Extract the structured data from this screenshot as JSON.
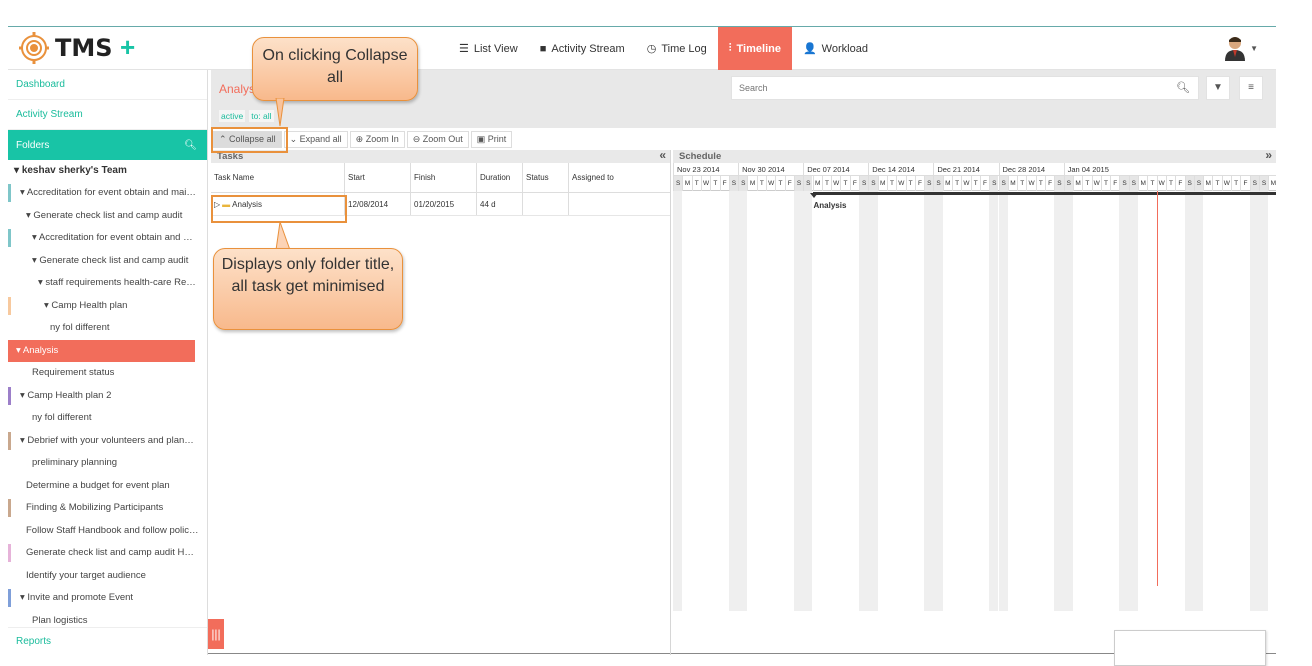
{
  "app": {
    "name": "TMS"
  },
  "nav": [
    {
      "label": "List View",
      "icon": "☰"
    },
    {
      "label": "Activity Stream",
      "icon": "■"
    },
    {
      "label": "Time Log",
      "icon": "◷"
    },
    {
      "label": "Timeline",
      "icon": "⫶"
    },
    {
      "label": "Workload",
      "icon": "👤"
    }
  ],
  "sidebar": {
    "dashboard": "Dashboard",
    "activity": "Activity Stream",
    "folders": "Folders",
    "team": "keshav sherky's Team",
    "items": [
      {
        "label": "Accreditation for event obtain and maintained",
        "indent": 1,
        "arrow": true,
        "color": "#7fc6c9"
      },
      {
        "label": "Generate check list and camp audit",
        "indent": 2,
        "arrow": true,
        "color": ""
      },
      {
        "label": "Accreditation for event obtain and maintained",
        "indent": 3,
        "arrow": true,
        "color": "#7fc6c9"
      },
      {
        "label": "Generate check list and camp audit",
        "indent": 3,
        "arrow": true,
        "color": ""
      },
      {
        "label": "staff requirements health-care Responsibilities",
        "indent": 4,
        "arrow": true,
        "color": ""
      },
      {
        "label": "Camp Health plan",
        "indent": 5,
        "arrow": true,
        "color": "#f7c99e"
      },
      {
        "label": "ny fol different",
        "indent": 6,
        "arrow": false,
        "color": ""
      },
      {
        "label": "Analysis",
        "indent": 1,
        "arrow": true,
        "color": "",
        "selected": true
      },
      {
        "label": "Requirement status",
        "indent": 3,
        "arrow": false,
        "color": ""
      },
      {
        "label": "Camp Health plan 2",
        "indent": 1,
        "arrow": true,
        "color": "#9c7fc9"
      },
      {
        "label": "ny fol different",
        "indent": 3,
        "arrow": false,
        "color": ""
      },
      {
        "label": "Debrief with your volunteers and planning",
        "indent": 1,
        "arrow": true,
        "color": "#c9a88e"
      },
      {
        "label": "preliminary planning",
        "indent": 3,
        "arrow": false,
        "color": ""
      },
      {
        "label": "Determine a budget for event plan",
        "indent": 2,
        "arrow": false,
        "color": ""
      },
      {
        "label": "Finding & Mobilizing Participants",
        "indent": 2,
        "arrow": false,
        "color": "#c9a88e"
      },
      {
        "label": "Follow Staff Handbook and follow policies",
        "indent": 2,
        "arrow": false,
        "color": ""
      },
      {
        "label": "Generate check list and camp audit Health",
        "indent": 2,
        "arrow": false,
        "color": "#e6b3d9"
      },
      {
        "label": "Identify your target audience",
        "indent": 2,
        "arrow": false,
        "color": ""
      },
      {
        "label": "Invite and promote Event",
        "indent": 1,
        "arrow": true,
        "color": "#7f9fd9"
      },
      {
        "label": "Plan logistics",
        "indent": 3,
        "arrow": false,
        "color": ""
      }
    ],
    "reports": "Reports"
  },
  "main": {
    "title": "Analysis",
    "chips": [
      "active",
      "to: all"
    ],
    "search_placeholder": "Search"
  },
  "toolbar": {
    "collapse": "Collapse all",
    "expand": "Expand all",
    "zoom_in": "Zoom In",
    "zoom_out": "Zoom Out",
    "print": "Print"
  },
  "grid": {
    "title": "Tasks",
    "columns": [
      "Task Name",
      "Start",
      "Finish",
      "Duration",
      "Status",
      "Assigned to"
    ],
    "rows": [
      {
        "name": "Analysis",
        "start": "12/08/2014",
        "finish": "01/20/2015",
        "duration": "44 d",
        "status": "",
        "assigned": ""
      }
    ]
  },
  "schedule": {
    "title": "Schedule",
    "weeks": [
      "Nov 23 2014",
      "Nov 30 2014",
      "Dec 07 2014",
      "Dec 14 2014",
      "Dec 21 2014",
      "Dec 28 2014",
      "Jan 04 2015"
    ],
    "day_letters": [
      "S",
      "M",
      "T",
      "W",
      "T",
      "F",
      "S"
    ],
    "bar_label": "Analysis",
    "bar_start_day": 15
  },
  "callouts": {
    "top": "On clicking Collapse all",
    "bottom": "Displays only folder title, all task get minimised"
  }
}
